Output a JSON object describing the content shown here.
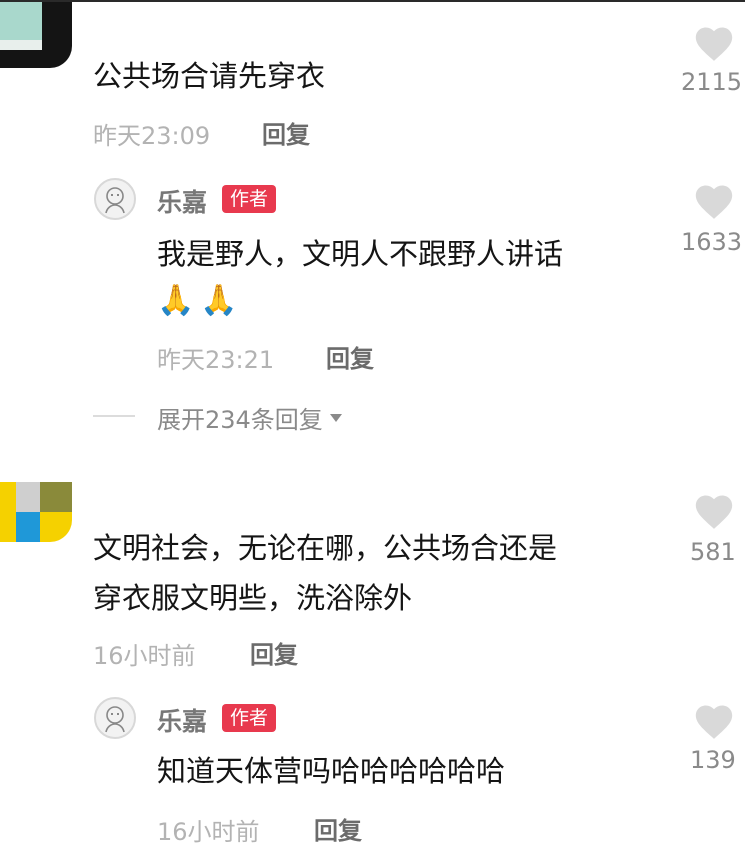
{
  "comments": [
    {
      "text": "公共场合请先穿衣",
      "time": "昨天23:09",
      "reply_label": "回复",
      "likes": "2115"
    },
    {
      "text_line1": "文明社会，无论在哪，公共场合还是",
      "text_line2": "穿衣服文明些，洗浴除外",
      "time": "16小时前",
      "reply_label": "回复",
      "likes": "581"
    }
  ],
  "replies": [
    {
      "name": "乐嘉",
      "badge": "作者",
      "text": "我是野人，文明人不跟野人讲话",
      "emoji": [
        "🙏",
        "🙏"
      ],
      "time": "昨天23:21",
      "reply_label": "回复",
      "likes": "1633",
      "expand_label": "展开234条回复"
    },
    {
      "name": "乐嘉",
      "badge": "作者",
      "text": "知道天体营吗哈哈哈哈哈哈",
      "time": "16小时前",
      "reply_label": "回复",
      "likes": "139"
    }
  ],
  "colors": {
    "author_badge": "#e8394e",
    "heart": "#d9d9d9"
  },
  "icons": {
    "like": "heart-icon",
    "expand": "caret-down-icon"
  }
}
